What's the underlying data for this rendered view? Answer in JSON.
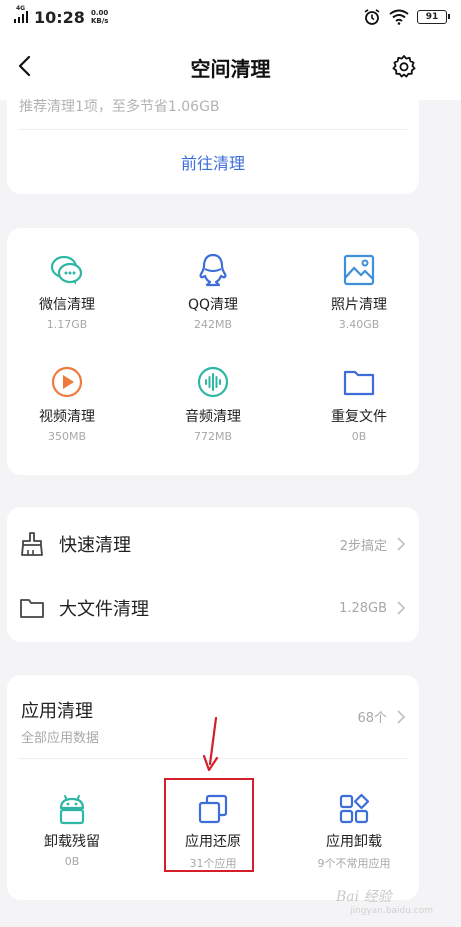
{
  "status_bar": {
    "network": "4G",
    "time": "10:28",
    "speed_value": "0.00",
    "speed_unit": "KB/s",
    "battery": "91"
  },
  "header": {
    "title": "空间清理"
  },
  "summary": {
    "recommend_text": "推荐清理1项，至多节省1.06GB",
    "action_label": "前往清理"
  },
  "categories": [
    {
      "label": "微信清理",
      "size": "1.17GB",
      "icon": "wechat-icon",
      "color": "#2fb6a4"
    },
    {
      "label": "QQ清理",
      "size": "242MB",
      "icon": "qq-icon",
      "color": "#3c6dd9"
    },
    {
      "label": "照片清理",
      "size": "3.40GB",
      "icon": "photo-icon",
      "color": "#3f8fd9"
    },
    {
      "label": "视频清理",
      "size": "350MB",
      "icon": "video-icon",
      "color": "#ef7a3d"
    },
    {
      "label": "音频清理",
      "size": "772MB",
      "icon": "audio-icon",
      "color": "#2fb6a4"
    },
    {
      "label": "重复文件",
      "size": "0B",
      "icon": "folder-icon",
      "color": "#3c6dd9"
    }
  ],
  "tools": [
    {
      "label": "快速清理",
      "value": "2步搞定",
      "icon": "broom-icon"
    },
    {
      "label": "大文件清理",
      "value": "1.28GB",
      "icon": "folder-outline-icon"
    }
  ],
  "app_cleanup": {
    "title": "应用清理",
    "subtitle": "全部应用数据",
    "count": "68个",
    "items": [
      {
        "label": "卸载残留",
        "sub": "0B",
        "icon": "android-icon",
        "color": "#2fb6a4"
      },
      {
        "label": "应用还原",
        "sub": "31个应用",
        "icon": "copy-icon",
        "color": "#3c6dd9"
      },
      {
        "label": "应用卸载",
        "sub": "9个不常用应用",
        "icon": "apps-grid-icon",
        "color": "#3c6dd9"
      }
    ]
  },
  "annotation": {
    "highlight_color": "#d21f2a"
  },
  "watermark": {
    "text": "Bai 经验",
    "url": "jingyan.baidu.com"
  }
}
